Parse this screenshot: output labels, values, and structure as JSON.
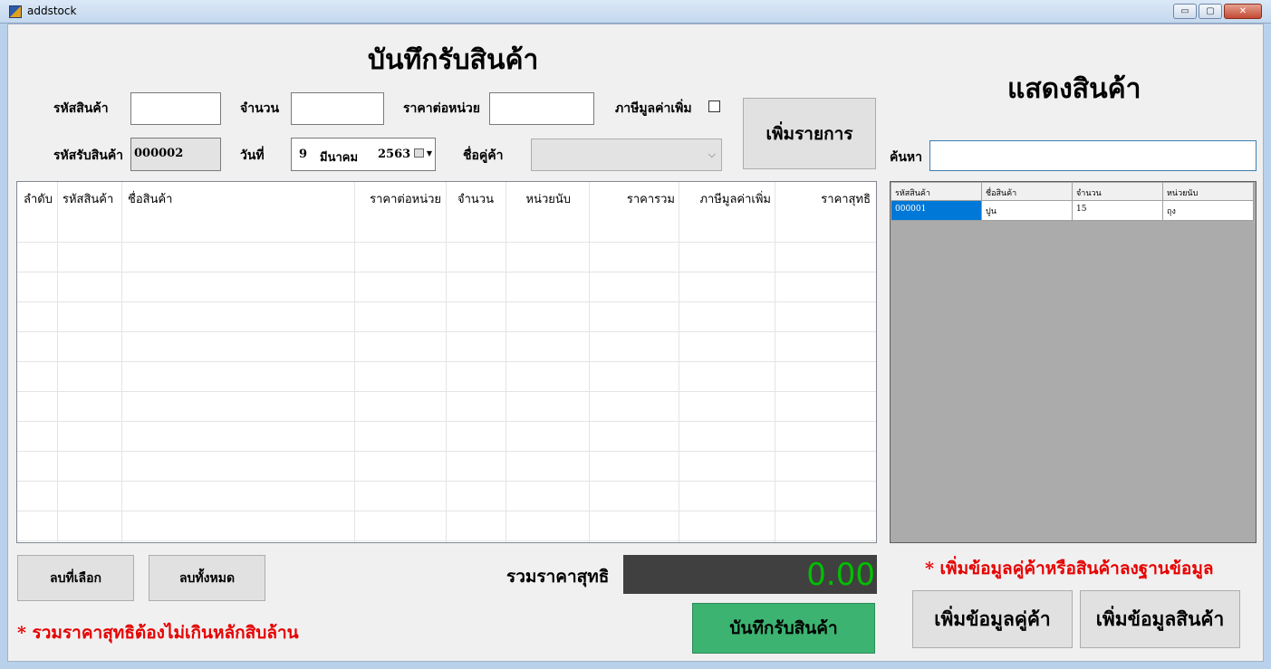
{
  "window": {
    "title": "addstock",
    "minimize": "▭",
    "maximize": "▢",
    "close": "✕"
  },
  "form": {
    "title": "บันทึกรับสินค้า",
    "product_code_label": "รหัสสินค้า",
    "quantity_label": "จำนวน",
    "unit_price_label": "ราคาต่อหน่วย",
    "vat_label": "ภาษีมูลค่าเพิ่ม",
    "vat_checked": false,
    "receipt_code_label": "รหัสรับสินค้า",
    "receipt_code_value": "000002",
    "date_label": "วันที่",
    "date_day": "9",
    "date_month": "มีนาคม",
    "date_year": "2563",
    "supplier_label": "ชื่อคู่ค้า",
    "supplier_value": "",
    "add_item_button": "เพิ่มรายการ"
  },
  "items_table": {
    "columns": [
      "ลำดับ",
      "รหัสสินค้า",
      "ชื่อสินค้า",
      "ราคาต่อหน่วย",
      "จำนวน",
      "หน่วยนับ",
      "ราคารวม",
      "ภาษีมูลค่าเพิ่ม",
      "ราคาสุทธิ"
    ],
    "rows": []
  },
  "actions": {
    "delete_selected": "ลบที่เลือก",
    "delete_all": "ลบทั้งหมด",
    "total_label": "รวมราคาสุทธิ",
    "total_value": "0.00",
    "save_button": "บันทึกรับสินค้า",
    "warning": "* รวมราคาสุทธิต้องไม่เกินหลักสิบล้าน"
  },
  "product_panel": {
    "title": "แสดงสินค้า",
    "search_label": "ค้นหา",
    "search_value": "",
    "columns": [
      "รหัสสินค้า",
      "ชื่อสินค้า",
      "จำนวน",
      "หน่วยนับ"
    ],
    "rows": [
      [
        "000001",
        "ปูน",
        "15",
        "ถุง"
      ]
    ],
    "note": "* เพิ่มข้อมูลคู่ค้าหรือสินค้าลงฐานข้อมูล",
    "add_supplier_button": "เพิ่มข้อมูลคู่ค้า",
    "add_product_button": "เพิ่มข้อมูลสินค้า"
  },
  "colors": {
    "total_text": "#00c000",
    "save_button_bg": "#3cb371",
    "warning_text": "#e60000",
    "selected_row": "#0078d7"
  }
}
